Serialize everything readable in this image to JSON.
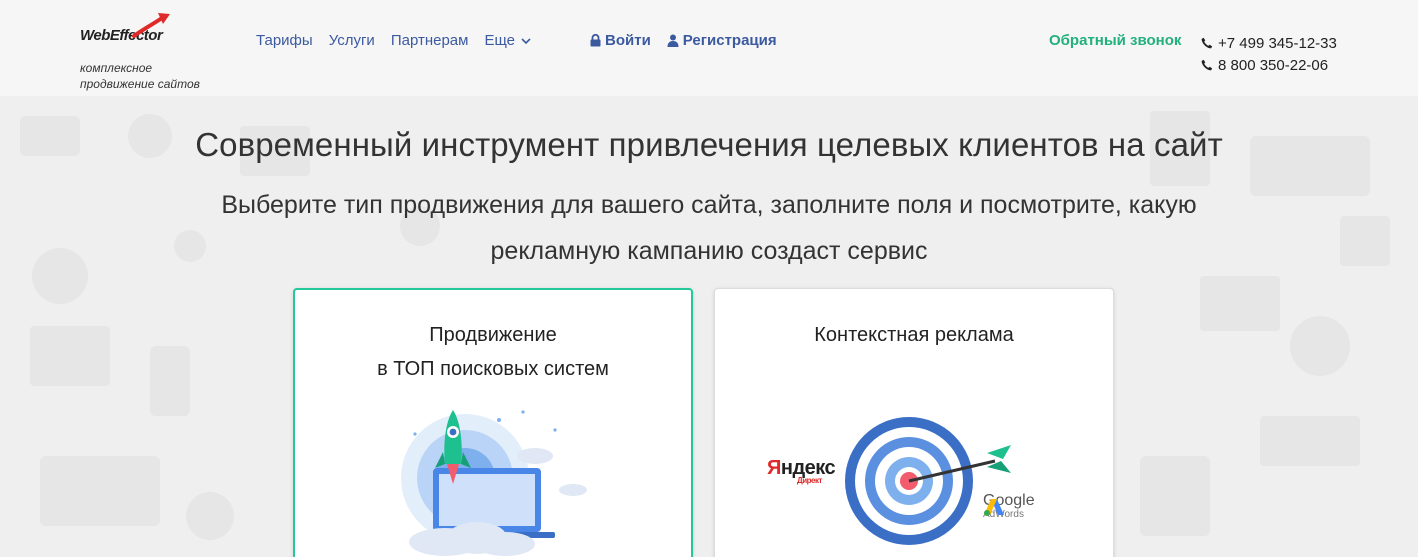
{
  "brand": {
    "logo_text": "WebEffector",
    "tagline_line1": "комплексное",
    "tagline_line2": "продвижение сайтов",
    "accent": "#e02a2a"
  },
  "nav": {
    "items": [
      {
        "label": "Тарифы"
      },
      {
        "label": "Услуги"
      },
      {
        "label": "Партнерам"
      },
      {
        "label": "Еще"
      }
    ]
  },
  "auth": {
    "login_label": "Войти",
    "register_label": "Регистрация"
  },
  "contact": {
    "callback_label": "Обратный звонок",
    "phone1": "+7 499 345-12-33",
    "phone2": "8 800 350-22-06"
  },
  "hero": {
    "title": "Современный инструмент привлечения целевых клиентов на сайт",
    "subtitle_line1": "Выберите тип продвижения для вашего сайта, заполните поля и посмотрите, какую",
    "subtitle_line2": "рекламную кампанию создаст сервис"
  },
  "cards": [
    {
      "title_line1": "Продвижение",
      "title_line2": "в ТОП поисковых систем",
      "selected": true
    },
    {
      "title_line1": "Контекстная реклама",
      "logo_left": "Яндекс",
      "logo_left_small": "Директ",
      "logo_right": "Google",
      "logo_right_small": "AdWords",
      "selected": false
    }
  ],
  "colors": {
    "link": "#3c5aa0",
    "callback": "#22b07d",
    "card_border_active": "#23c99a"
  },
  "icons": [
    "lock-icon",
    "user-icon",
    "phone-icon",
    "chevron-down-icon",
    "rocket-icon",
    "target-icon",
    "arrow-icon",
    "adwords-icon"
  ]
}
